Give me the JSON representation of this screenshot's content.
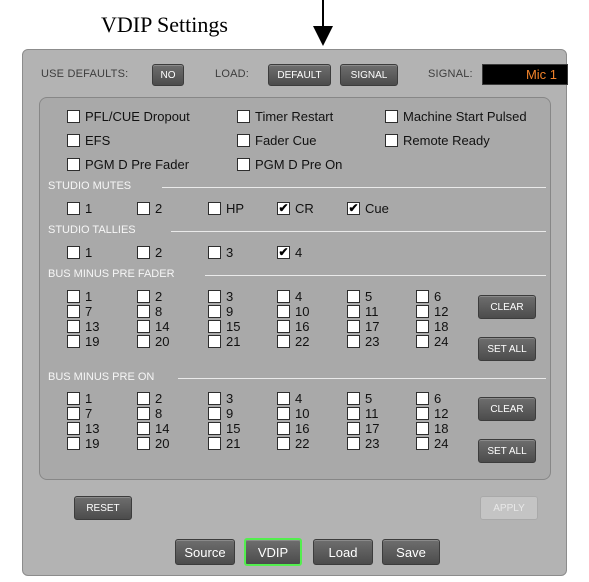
{
  "caption": "VDIP Settings",
  "top": {
    "use_defaults_label": "USE DEFAULTS:",
    "no_btn": "NO",
    "load_label": "LOAD:",
    "default_btn": "DEFAULT",
    "signal_btn": "SIGNAL",
    "signal_label": "SIGNAL:",
    "signal_value": "Mic 1"
  },
  "options": [
    {
      "label": "PFL/CUE Dropout",
      "checked": false
    },
    {
      "label": "Timer Restart",
      "checked": false
    },
    {
      "label": "Machine Start Pulsed",
      "checked": false
    },
    {
      "label": "EFS",
      "checked": false
    },
    {
      "label": "Fader Cue",
      "checked": false
    },
    {
      "label": "Remote Ready",
      "checked": false
    },
    {
      "label": "PGM D Pre Fader",
      "checked": false
    },
    {
      "label": "PGM D Pre On",
      "checked": false
    }
  ],
  "studio_mutes": {
    "title": "STUDIO MUTES",
    "items": [
      {
        "label": "1",
        "checked": false
      },
      {
        "label": "2",
        "checked": false
      },
      {
        "label": "HP",
        "checked": false
      },
      {
        "label": "CR",
        "checked": true
      },
      {
        "label": "Cue",
        "checked": true
      }
    ]
  },
  "studio_tallies": {
    "title": "STUDIO TALLIES",
    "items": [
      {
        "label": "1",
        "checked": false
      },
      {
        "label": "2",
        "checked": false
      },
      {
        "label": "3",
        "checked": false
      },
      {
        "label": "4",
        "checked": true
      }
    ]
  },
  "bus_pre_fader": {
    "title": "BUS MINUS PRE FADER",
    "numbers": [
      "1",
      "2",
      "3",
      "4",
      "5",
      "6",
      "7",
      "8",
      "9",
      "10",
      "11",
      "12",
      "13",
      "14",
      "15",
      "16",
      "17",
      "18",
      "19",
      "20",
      "21",
      "22",
      "23",
      "24"
    ],
    "clear": "CLEAR",
    "set_all": "SET ALL"
  },
  "bus_pre_on": {
    "title": "BUS MINUS PRE ON",
    "numbers": [
      "1",
      "2",
      "3",
      "4",
      "5",
      "6",
      "7",
      "8",
      "9",
      "10",
      "11",
      "12",
      "13",
      "14",
      "15",
      "16",
      "17",
      "18",
      "19",
      "20",
      "21",
      "22",
      "23",
      "24"
    ],
    "clear": "CLEAR",
    "set_all": "SET ALL"
  },
  "bottom": {
    "reset": "RESET",
    "apply": "APPLY"
  },
  "nav": [
    {
      "label": "Source",
      "active": false
    },
    {
      "label": "VDIP",
      "active": true
    },
    {
      "label": "Load",
      "active": false
    },
    {
      "label": "Save",
      "active": false
    }
  ],
  "colors": {
    "signal_text": "#f0822a",
    "active_border": "#53ee4e"
  }
}
